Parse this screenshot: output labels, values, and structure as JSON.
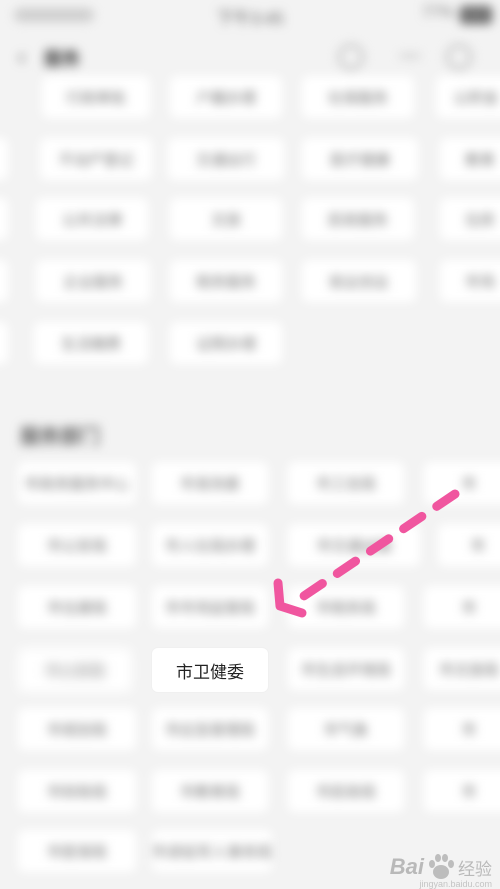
{
  "status_bar": {
    "time": "下午3:45",
    "battery": "77%"
  },
  "nav": {
    "back_icon": "chevron-left-icon",
    "title": "服务"
  },
  "top_rows": [
    [
      "行政审批",
      "户籍办理",
      "社保服务",
      "公积金"
    ],
    [
      "不动产登记",
      "交通出行",
      "医疗健康",
      "教育"
    ],
    [
      "公共法律",
      "文旅",
      "民政服务",
      "住房"
    ],
    [
      "企业服务",
      "税务服务",
      "就业创业",
      "市场"
    ],
    [
      "生活缴费",
      "证照办理"
    ]
  ],
  "section": {
    "title": "服务部门"
  },
  "dept_rows": [
    [
      "市政务服务中心",
      "市发改委",
      "市工信局",
      "市"
    ],
    [
      "市公安局",
      "市人社局办理",
      "市交通运输",
      "市"
    ],
    [
      "市住建局",
      "市市场监管局",
      "市税务局",
      "市"
    ],
    [
      "市公安局",
      "市卫健委",
      "市生态环境局",
      "市文旅局"
    ],
    [
      "市规划局",
      "市应急管理局",
      "市气象",
      "市"
    ],
    [
      "市财政局",
      "市教育局",
      "市民政局",
      "市"
    ],
    [
      "市医保局",
      "市退役军人事务局"
    ]
  ],
  "focused_department": "市卫健委",
  "colors": {
    "arrow": "#f0569f",
    "background": "#f3f3f3",
    "chip": "#ffffff"
  },
  "watermark": {
    "brand_prefix": "Bai",
    "brand_suffix": "经验",
    "logo": "baidu-paw-icon",
    "url": "jingyan.baidu.com"
  }
}
